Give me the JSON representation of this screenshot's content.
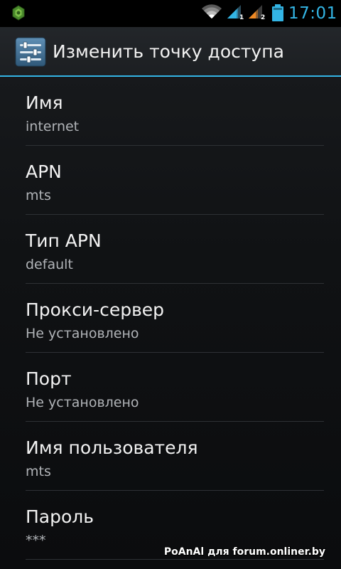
{
  "status_bar": {
    "time": "17:01",
    "sim1_label": "1",
    "sim2_label": "2",
    "icons": [
      "app-notification-icon",
      "wifi-icon",
      "signal-sim1-icon",
      "signal-sim2-icon",
      "battery-icon"
    ],
    "colors": {
      "time": "#33b5e5",
      "sim1_signal": "#33b5e5",
      "sim2_signal": "#f08a24",
      "battery": "#33b5e5"
    }
  },
  "action_bar": {
    "title": "Изменить точку доступа",
    "icon": "settings-sliders-icon",
    "accent_color": "#33b5e5"
  },
  "preferences": [
    {
      "title": "Имя",
      "summary": "internet"
    },
    {
      "title": "APN",
      "summary": "mts"
    },
    {
      "title": "Тип APN",
      "summary": "default"
    },
    {
      "title": "Прокси-сервер",
      "summary": "Не установлено"
    },
    {
      "title": "Порт",
      "summary": "Не установлено"
    },
    {
      "title": "Имя пользователя",
      "summary": "mts"
    },
    {
      "title": "Пароль",
      "summary": "***"
    }
  ],
  "watermark": "PoAnAl для forum.onliner.by"
}
